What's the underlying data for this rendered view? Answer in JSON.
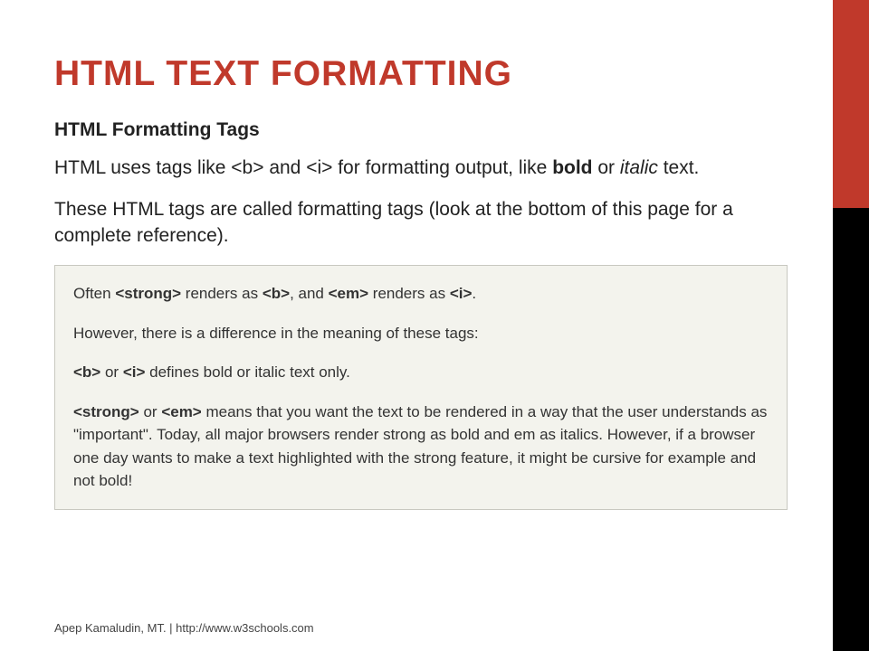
{
  "title": "HTML TEXT FORMATTING",
  "subheading": "HTML Formatting Tags",
  "para1": {
    "pre": "HTML uses tags like <b> and <i> for formatting output, like ",
    "bold": "bold",
    "mid": " or ",
    "italic": "italic",
    "post": " text."
  },
  "para2": "These HTML tags are called formatting tags (look at the bottom of this page for a complete reference).",
  "box": {
    "line1": {
      "pre": "Often ",
      "b1": "<strong>",
      "mid1": " renders as ",
      "b2": "<b>",
      "mid2": ", and ",
      "b3": "<em>",
      "mid3": " renders as ",
      "b4": "<i>",
      "post": "."
    },
    "line2": "However, there is a difference in the meaning of these tags:",
    "line3": {
      "b1": "<b>",
      "mid": " or ",
      "b2": "<i>",
      "post": " defines bold or italic text only."
    },
    "line4": {
      "b1": "<strong>",
      "mid": " or ",
      "b2": "<em>",
      "post": " means that you want the text to be rendered in a way that the user understands as \"important\". Today, all major browsers render strong as bold and em as italics. However, if a browser one day wants to make a text highlighted with the strong feature, it might be cursive for example and not bold!"
    }
  },
  "footer": "Apep Kamaludin, MT.  |   http://www.w3schools.com"
}
